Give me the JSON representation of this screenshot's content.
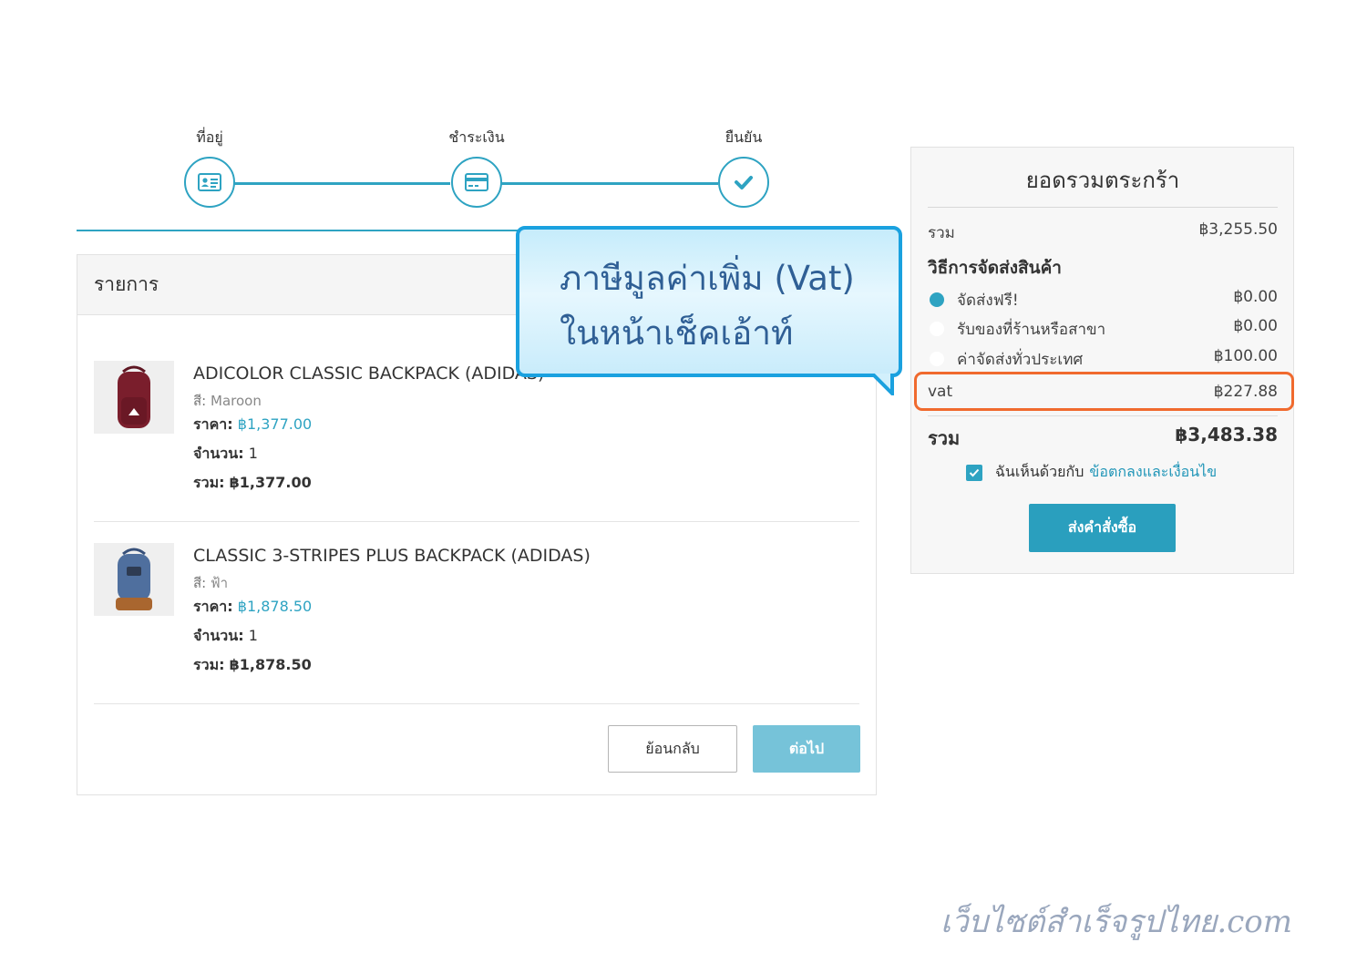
{
  "stepper": {
    "steps": [
      {
        "label": "ที่อยู่",
        "icon": "address-card-icon"
      },
      {
        "label": "ชำระเงิน",
        "icon": "credit-card-icon"
      },
      {
        "label": "ยืนยัน",
        "icon": "checkmark-icon"
      }
    ]
  },
  "items_panel": {
    "header": "รายการ",
    "color_label": "สี:",
    "price_label": "ราคา:",
    "qty_label": "จำนวน:",
    "total_label": "รวม:",
    "items": [
      {
        "name": "ADICOLOR CLASSIC BACKPACK (ADIDAS)",
        "color": "Maroon",
        "price": "฿1,377.00",
        "qty": "1",
        "total": "฿1,377.00",
        "thumb_color": "#7a1e2c"
      },
      {
        "name": "CLASSIC 3-STRIPES PLUS BACKPACK (ADIDAS)",
        "color": "ฟ้า",
        "price": "฿1,878.50",
        "qty": "1",
        "total": "฿1,878.50",
        "thumb_color": "#4f6f9e"
      }
    ],
    "back_button": "ย้อนกลับ",
    "next_button": "ต่อไป"
  },
  "summary": {
    "title": "ยอดรวมตระกร้า",
    "subtotal_label": "รวม",
    "subtotal_value": "฿3,255.50",
    "shipping_heading": "วิธีการจัดส่งสินค้า",
    "shipping_options": [
      {
        "label": "จัดส่งฟรี!",
        "value": "฿0.00",
        "selected": true
      },
      {
        "label": "รับของที่ร้านหรือสาขา",
        "value": "฿0.00",
        "selected": false
      },
      {
        "label": "ค่าจัดส่งทั่วประเทศ",
        "value": "฿100.00",
        "selected": false
      }
    ],
    "vat_label": "vat",
    "vat_value": "฿227.88",
    "total_label": "รวม",
    "total_value": "฿3,483.38",
    "agree_text": "ฉันเห็นด้วยกับ",
    "agree_link": "ข้อตกลงและเงื่อนไข",
    "order_button": "ส่งคำสั่งซื้อ"
  },
  "callout": {
    "line1": "ภาษีมูลค่าเพิ่ม (Vat)",
    "line2": "ในหน้าเช็คเอ้าท์"
  },
  "watermark": "เว็บไซต์สำเร็จรูปไทย.com",
  "colors": {
    "accent": "#2ea3c2",
    "highlight": "#f06a2e",
    "callout_border": "#1aa1df"
  }
}
